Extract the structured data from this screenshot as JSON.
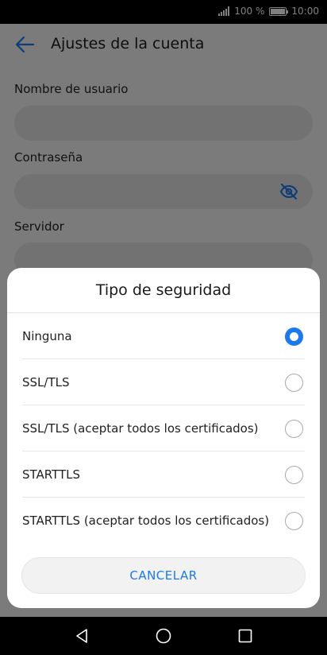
{
  "status_bar": {
    "battery_text": "100 %",
    "time": "10:00",
    "battery_level": 1.0
  },
  "header": {
    "title": "Ajustes de la cuenta",
    "back_icon": "arrow-left-icon"
  },
  "form": {
    "fields": [
      {
        "label": "Nombre de usuario",
        "value": ""
      },
      {
        "label": "Contraseña",
        "value": "",
        "icon": "eye-off-icon"
      },
      {
        "label": "Servidor",
        "value": ""
      }
    ]
  },
  "dialog": {
    "title": "Tipo de seguridad",
    "options": [
      {
        "label": "Ninguna",
        "selected": true
      },
      {
        "label": "SSL/TLS",
        "selected": false
      },
      {
        "label": "SSL/TLS (aceptar todos los certificados)",
        "selected": false
      },
      {
        "label": "STARTTLS",
        "selected": false
      },
      {
        "label": "STARTTLS (aceptar todos los certificados)",
        "selected": false
      }
    ],
    "cancel_label": "CANCELAR"
  },
  "colors": {
    "accent": "#1a79f0",
    "input_bg": "#e4e4e4"
  },
  "nav_bar": {
    "icons": [
      "back-triangle-icon",
      "home-circle-icon",
      "recents-square-icon"
    ]
  }
}
